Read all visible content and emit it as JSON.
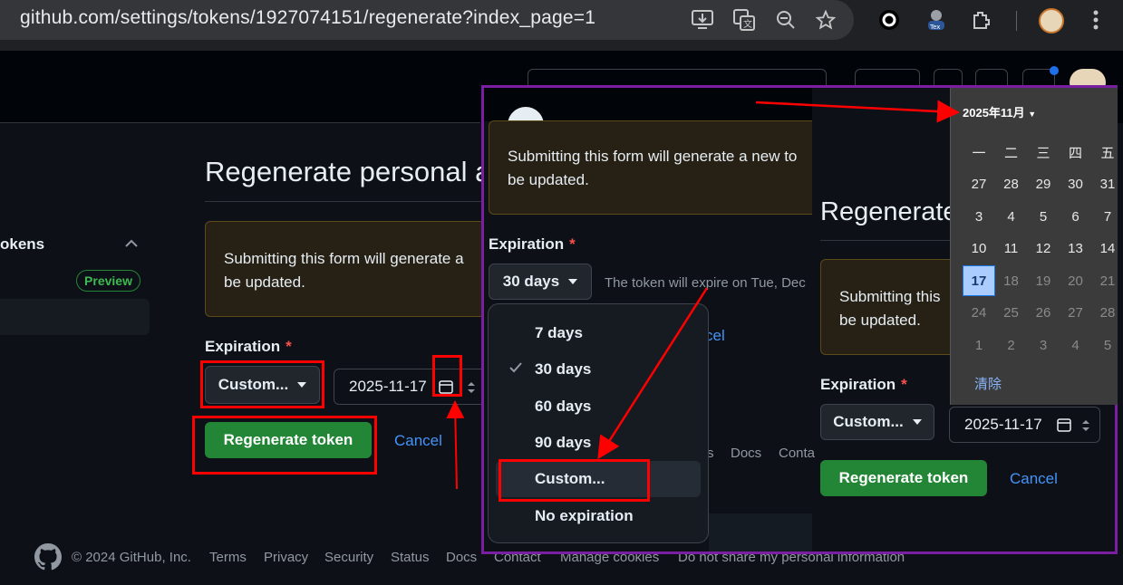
{
  "browser": {
    "url": "github.com/settings/tokens/1927074151/regenerate?index_page=1",
    "icons": [
      "install-icon",
      "translate-icon",
      "zoom-icon",
      "star-icon",
      "record-icon",
      "profile-extension-icon",
      "extensions-icon",
      "avatar",
      "menu-icon"
    ]
  },
  "sidebar": {
    "section_label": "okens",
    "badge": "Preview"
  },
  "main": {
    "title": "Regenerate personal ac",
    "flash_line1": "Submitting this form will generate a",
    "flash_line2": "be updated.",
    "expiration_label": "Expiration",
    "required_mark": "*",
    "expiration_select": "Custom...",
    "date_value": "2025-11-17",
    "regenerate_button": "Regenerate token",
    "cancel_link": "Cancel"
  },
  "footer": {
    "copyright": "© 2024 GitHub, Inc.",
    "links": [
      "Terms",
      "Privacy",
      "Security",
      "Status",
      "Docs",
      "Contact",
      "Manage cookies",
      "Do not share my personal information"
    ]
  },
  "overlay_left": {
    "flash_line1": "Submitting this form will generate a new to",
    "flash_line2": "be updated.",
    "expiration_label": "Expiration",
    "required_mark": "*",
    "select_value": "30 days",
    "expire_note": "The token will expire on Tue, Dec",
    "cancel_partial": "cel",
    "dropdown_items": [
      {
        "label": "7 days",
        "checked": false
      },
      {
        "label": "30 days",
        "checked": true
      },
      {
        "label": "60 days",
        "checked": false
      },
      {
        "label": "90 days",
        "checked": false
      },
      {
        "label": "Custom...",
        "checked": false
      },
      {
        "label": "No expiration",
        "checked": false
      }
    ],
    "footer_partial": [
      "s",
      "Docs",
      "Conta"
    ]
  },
  "overlay_right": {
    "title": "Regenerate",
    "flash_line1": "Submitting this",
    "flash_line2": "be updated.",
    "expiration_label": "Expiration",
    "required_mark": "*",
    "select_value": "Custom...",
    "date_value": "2025-11-17",
    "regenerate_button": "Regenerate token",
    "cancel_link": "Cancel"
  },
  "calendar": {
    "month_label": "2025年11月",
    "weekdays": [
      "一",
      "二",
      "三",
      "四",
      "五"
    ],
    "rows": [
      [
        {
          "d": "27",
          "dim": false
        },
        {
          "d": "28",
          "dim": false
        },
        {
          "d": "29",
          "dim": false
        },
        {
          "d": "30",
          "dim": false
        },
        {
          "d": "31",
          "dim": false
        }
      ],
      [
        {
          "d": "3",
          "dim": false
        },
        {
          "d": "4",
          "dim": false
        },
        {
          "d": "5",
          "dim": false
        },
        {
          "d": "6",
          "dim": false
        },
        {
          "d": "7",
          "dim": false
        }
      ],
      [
        {
          "d": "10",
          "dim": false
        },
        {
          "d": "11",
          "dim": false
        },
        {
          "d": "12",
          "dim": false
        },
        {
          "d": "13",
          "dim": false
        },
        {
          "d": "14",
          "dim": false
        }
      ],
      [
        {
          "d": "17",
          "dim": false,
          "sel": true
        },
        {
          "d": "18",
          "dim": true
        },
        {
          "d": "19",
          "dim": true
        },
        {
          "d": "20",
          "dim": true
        },
        {
          "d": "21",
          "dim": true
        }
      ],
      [
        {
          "d": "24",
          "dim": true
        },
        {
          "d": "25",
          "dim": true
        },
        {
          "d": "26",
          "dim": true
        },
        {
          "d": "27",
          "dim": true
        },
        {
          "d": "28",
          "dim": true
        }
      ],
      [
        {
          "d": "1",
          "dim": true
        },
        {
          "d": "2",
          "dim": true
        },
        {
          "d": "3",
          "dim": true
        },
        {
          "d": "4",
          "dim": true
        },
        {
          "d": "5",
          "dim": true
        }
      ]
    ],
    "clear_label": "清除"
  },
  "colors": {
    "annotation_red": "#ff0000",
    "overlay_border": "#7b1fa2",
    "accent_green": "#238636",
    "link_blue": "#4493f8"
  }
}
